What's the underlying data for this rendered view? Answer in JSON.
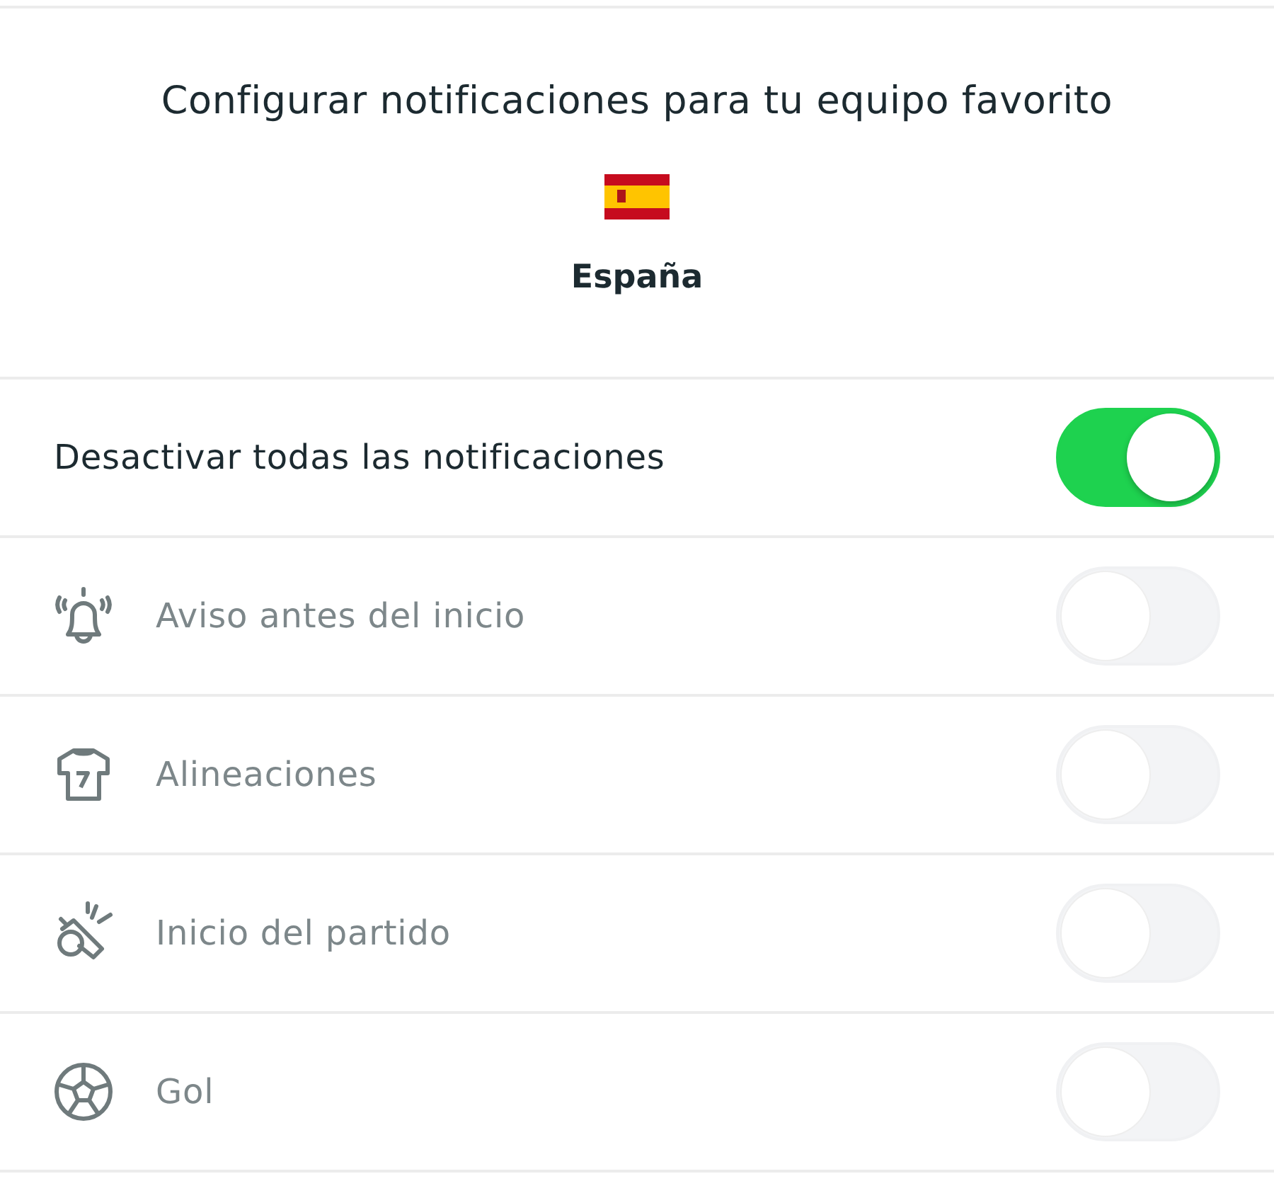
{
  "header": {
    "title": "Configurar notificaciones para tu equipo favorito",
    "team": "España"
  },
  "master": {
    "label": "Desactivar todas las notificaciones",
    "on": true
  },
  "options": [
    {
      "label": "Aviso antes del inicio",
      "on": false,
      "disabled": true
    },
    {
      "label": "Alineaciones",
      "on": false,
      "disabled": true
    },
    {
      "label": "Inicio del partido",
      "on": false,
      "disabled": true
    },
    {
      "label": "Gol",
      "on": false,
      "disabled": true
    }
  ]
}
